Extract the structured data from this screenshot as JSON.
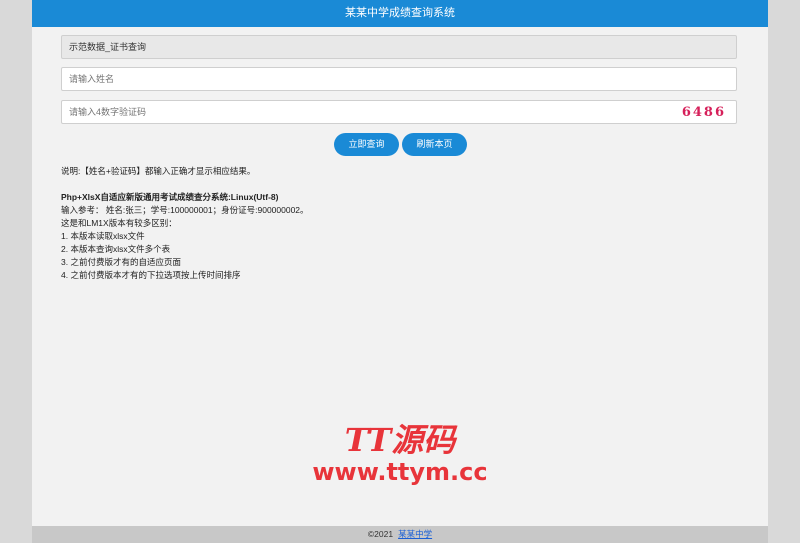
{
  "header": {
    "title": "某某中学成绩查询系统"
  },
  "form": {
    "dataset_select": "示范数据_证书查询",
    "name_placeholder": "请输入姓名",
    "code_placeholder": "请输入4数字验证码",
    "captcha": "6486",
    "query_button": "立即查询",
    "refresh_button": "刷新本页"
  },
  "info": {
    "note": "说明:【姓名+验证码】都输入正确才显示相应结果。",
    "heading": "Php+XlsX自适应新版通用考试成绩查分系统:Linux(Utf-8)",
    "sample": "输入参考： 姓名:张三；学号:100000001；身份证号:900000002。",
    "diff_intro": "这是和LM1X版本有较多区别：",
    "items": [
      "1. 本版本读取xlsx文件",
      "2. 本版本查询xlsx文件多个表",
      "3. 之前付费版才有的自适应页面",
      "4. 之前付费版本才有的下拉选项按上传时间排序"
    ]
  },
  "watermark": {
    "title": "TT源码",
    "url": "www.ttym.cc"
  },
  "footer": {
    "copyright": "©2021",
    "link": "某某中学"
  }
}
